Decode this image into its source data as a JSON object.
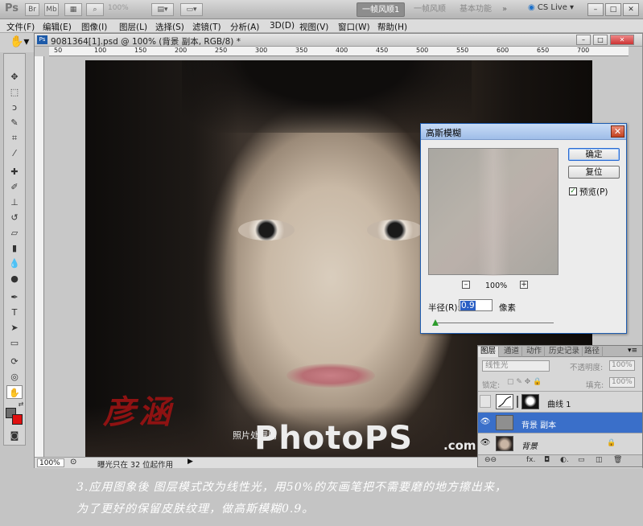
{
  "app": {
    "logo": "Ps",
    "zoom": "100%",
    "workspaces": [
      "一帧风顺1",
      "一帧风顺",
      "基本功能"
    ],
    "cs_live": "CS Live"
  },
  "menu": [
    "文件(F)",
    "编辑(E)",
    "图像(I)",
    "图层(L)",
    "选择(S)",
    "滤镜(T)",
    "分析(A)",
    "3D(D)",
    "视图(V)",
    "窗口(W)",
    "帮助(H)"
  ],
  "document": {
    "title": "9081364[1].psd @ 100% (背景 副本, RGB/8) *",
    "ruler_ticks": [
      "50",
      "100",
      "150",
      "200",
      "250",
      "300",
      "350",
      "400",
      "450",
      "500",
      "550",
      "600",
      "650",
      "700"
    ],
    "zoom": "100%",
    "status": "曝光只在 32 位起作用"
  },
  "image": {
    "signature": "彦涵",
    "watermark_small": "照片处理网",
    "watermark_big": "PhotoPS",
    "watermark_tld": ".com"
  },
  "dialog": {
    "title": "高斯模糊",
    "ok_label": "确定",
    "reset_label": "复位",
    "preview_label": "预览(P)",
    "zoom_pct": "100%",
    "radius_label": "半径(R):",
    "radius_value": "0.9",
    "radius_unit": "像素"
  },
  "layers_panel": {
    "tabs": [
      "图层",
      "通道",
      "动作",
      "历史记录",
      "路径"
    ],
    "blend_mode": "线性光",
    "opacity_label": "不透明度:",
    "opacity": "100%",
    "lock_label": "锁定:",
    "fill_label": "填充:",
    "fill": "100%",
    "layers": [
      {
        "name": "曲线 1",
        "visible": false,
        "selected": false
      },
      {
        "name": "背景 副本",
        "visible": true,
        "selected": true
      },
      {
        "name": "背景",
        "visible": true,
        "selected": false,
        "locked": true
      }
    ]
  },
  "caption": {
    "line1": "3.应用图象後 图层模式改为线性光，用50%的灰画笔把不需要磨的地方擦出来，",
    "line2": "为了更好的保留皮肤纹理，做高斯模糊0.9。"
  }
}
